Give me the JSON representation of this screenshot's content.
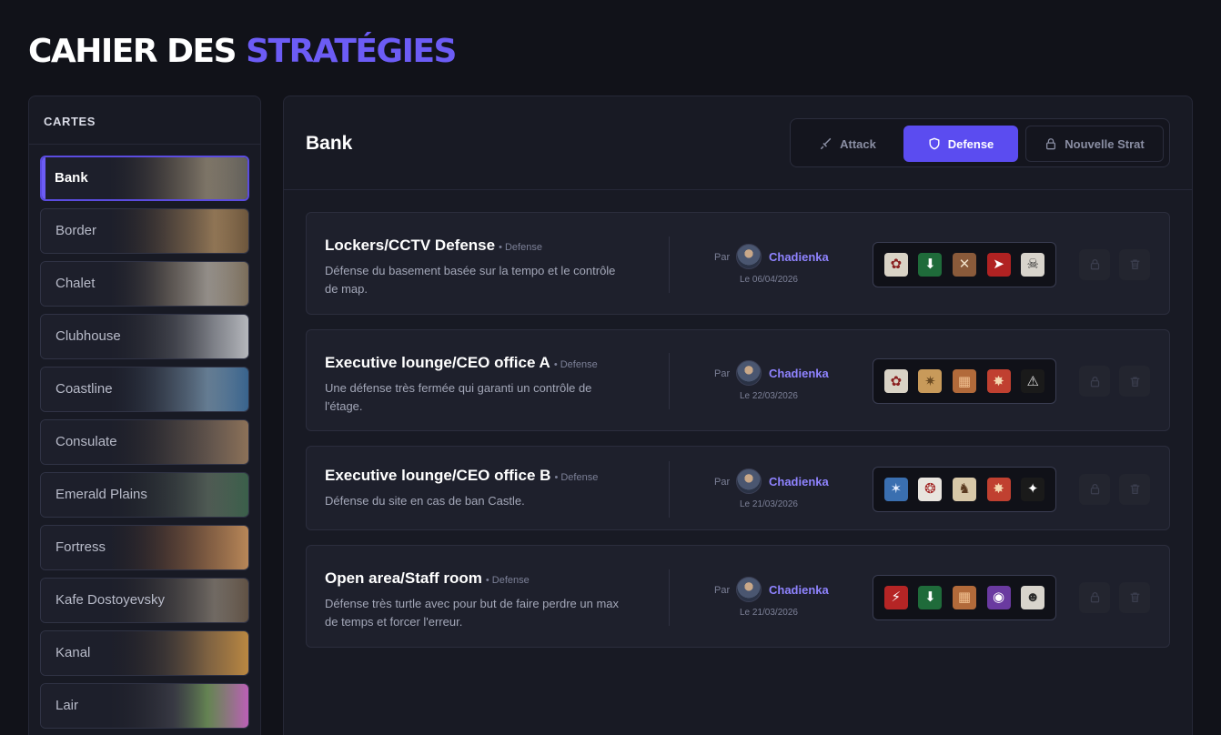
{
  "app": {
    "title_white": "CAHIER DES ",
    "title_accent": "STRATÉGIES"
  },
  "sidebar": {
    "heading": "CARTES",
    "items": [
      {
        "label": "Bank",
        "active": true,
        "bg": "linear-gradient(90deg,#3a3530,#8a7a62 40%,#b7a88b 70%,#6d6a62)"
      },
      {
        "label": "Border",
        "active": false,
        "bg": "linear-gradient(90deg,#3b3126,#9b7b55 45%,#c9a06a 75%,#7a5f3f)"
      },
      {
        "label": "Chalet",
        "active": false,
        "bg": "linear-gradient(90deg,#3a3631,#a8977e 40%,#d8cfbf 70%,#8a7a62)"
      },
      {
        "label": "Clubhouse",
        "active": false,
        "bg": "linear-gradient(90deg,#2e2e30,#6d6f73 45%,#b0b3b8 75%,#d0d2d6)"
      },
      {
        "label": "Coastline",
        "active": false,
        "bg": "linear-gradient(90deg,#2a3340,#6a7f94 40%,#8fb3cf 70%,#3d6f9e)"
      },
      {
        "label": "Consulate",
        "active": false,
        "bg": "linear-gradient(90deg,#2f2b28,#6b5d50 45%,#8c7560 75%,#a08060)"
      },
      {
        "label": "Emerald Plains",
        "active": false,
        "bg": "linear-gradient(90deg,#262c29,#4f5a52 45%,#6c7d6b 70%,#3f6a4f)"
      },
      {
        "label": "Fortress",
        "active": false,
        "bg": "linear-gradient(90deg,#3a2a20,#8a5a3a 40%,#b98050 70%,#d49a60)"
      },
      {
        "label": "Kafe Dostoyevsky",
        "active": false,
        "bg": "linear-gradient(90deg,#2d2a28,#6a6258 45%,#9a8f7f 75%,#6c5a48)"
      },
      {
        "label": "Kanal",
        "active": false,
        "bg": "linear-gradient(90deg,#2e2620,#6d5a45 40%,#b88a4f 70%,#d69a45)"
      },
      {
        "label": "Lair",
        "active": false,
        "bg": "linear-gradient(90deg,#2c2b2e,#5a5a62 45%,#8fbf6a 70%,#d86ad0)"
      }
    ]
  },
  "main": {
    "map_name": "Bank",
    "tabs": [
      {
        "label": "Attack",
        "icon": "sword-icon"
      },
      {
        "label": "Defense",
        "icon": "shield-icon"
      },
      {
        "label": "Nouvelle Strat",
        "icon": "lock-icon"
      }
    ],
    "strategies": [
      {
        "title": "Lockers/CCTV Defense",
        "tag": "• Defense",
        "desc": "Défense du basement basée sur la tempo et le contrôle de map.",
        "par": "Par",
        "author": "Chadienka",
        "date": "Le 06/04/2026",
        "operators": [
          {
            "glyph": "✿",
            "bg": "#d9d3c6",
            "fg": "#8a1f1f"
          },
          {
            "glyph": "⬇",
            "bg": "#1f6b3a",
            "fg": "#ffffff"
          },
          {
            "glyph": "✕",
            "bg": "#8a5a3a",
            "fg": "#f0e0c8"
          },
          {
            "glyph": "➤",
            "bg": "#b02222",
            "fg": "#ffffff"
          },
          {
            "glyph": "☠",
            "bg": "#d8d4cc",
            "fg": "#2b2b2b"
          }
        ]
      },
      {
        "title": "Executive lounge/CEO office A",
        "tag": "• Defense",
        "desc": "Une défense très fermée qui garanti un contrôle de l'étage.",
        "par": "Par",
        "author": "Chadienka",
        "date": "Le 22/03/2026",
        "operators": [
          {
            "glyph": "✿",
            "bg": "#d9d3c6",
            "fg": "#8a1f1f"
          },
          {
            "glyph": "✷",
            "bg": "#c89a5a",
            "fg": "#6a4a22"
          },
          {
            "glyph": "▦",
            "bg": "#b26a3a",
            "fg": "#f0c090"
          },
          {
            "glyph": "✸",
            "bg": "#c04030",
            "fg": "#f4d8b0"
          },
          {
            "glyph": "⚠",
            "bg": "#1a1a1a",
            "fg": "#e0e0e0"
          }
        ]
      },
      {
        "title": "Executive lounge/CEO office B",
        "tag": "• Defense",
        "desc": "Défense du site en cas de ban Castle.",
        "par": "Par",
        "author": "Chadienka",
        "date": "Le 21/03/2026",
        "operators": [
          {
            "glyph": "✶",
            "bg": "#3a6fb0",
            "fg": "#e8f0ff"
          },
          {
            "glyph": "❂",
            "bg": "#e8e4de",
            "fg": "#a02020"
          },
          {
            "glyph": "♞",
            "bg": "#d8c8a8",
            "fg": "#5a3a20"
          },
          {
            "glyph": "✸",
            "bg": "#c04030",
            "fg": "#f4d8b0"
          },
          {
            "glyph": "✦",
            "bg": "#1a1a1a",
            "fg": "#ffffff"
          }
        ]
      },
      {
        "title": "Open area/Staff room",
        "tag": "• Defense",
        "desc": "Défense très turtle avec pour but de faire perdre un max de temps et forcer l'erreur.",
        "par": "Par",
        "author": "Chadienka",
        "date": "Le 21/03/2026",
        "operators": [
          {
            "glyph": "⚡",
            "bg": "#b52525",
            "fg": "#ffffff"
          },
          {
            "glyph": "⬇",
            "bg": "#1f6b3a",
            "fg": "#ffffff"
          },
          {
            "glyph": "▦",
            "bg": "#b26a3a",
            "fg": "#f0c090"
          },
          {
            "glyph": "◉",
            "bg": "#6a3aa0",
            "fg": "#ffffff"
          },
          {
            "glyph": "☻",
            "bg": "#d8d4cc",
            "fg": "#2b2b2b"
          }
        ]
      }
    ]
  }
}
